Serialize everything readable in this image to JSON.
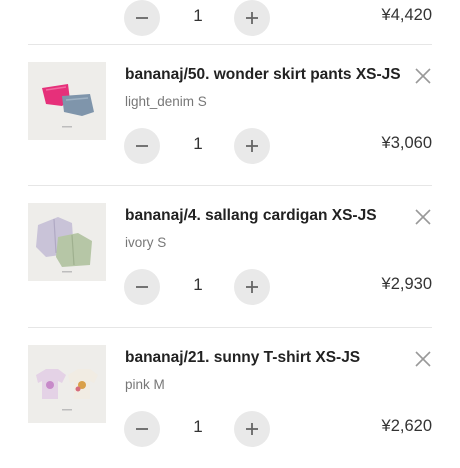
{
  "cart": {
    "items": [
      {
        "name": "",
        "variant": "",
        "quantity": "1",
        "price": "¥4,420"
      },
      {
        "name": "bananaj/50. wonder skirt pants XS-JS",
        "variant": "light_denim S",
        "quantity": "1",
        "price": "¥3,060"
      },
      {
        "name": "bananaj/4. sallang cardigan XS-JS",
        "variant": "ivory S",
        "quantity": "1",
        "price": "¥2,930"
      },
      {
        "name": "bananaj/21. sunny T-shirt XS-JS",
        "variant": "pink M",
        "quantity": "1",
        "price": "¥2,620"
      }
    ]
  },
  "icons": {
    "remove": "close-icon",
    "decrease": "minus-icon",
    "increase": "plus-icon"
  },
  "colors": {
    "button_bg": "#e9e9e9",
    "divider": "#e6e6e6",
    "text_primary": "#222222",
    "text_secondary": "#777777"
  }
}
